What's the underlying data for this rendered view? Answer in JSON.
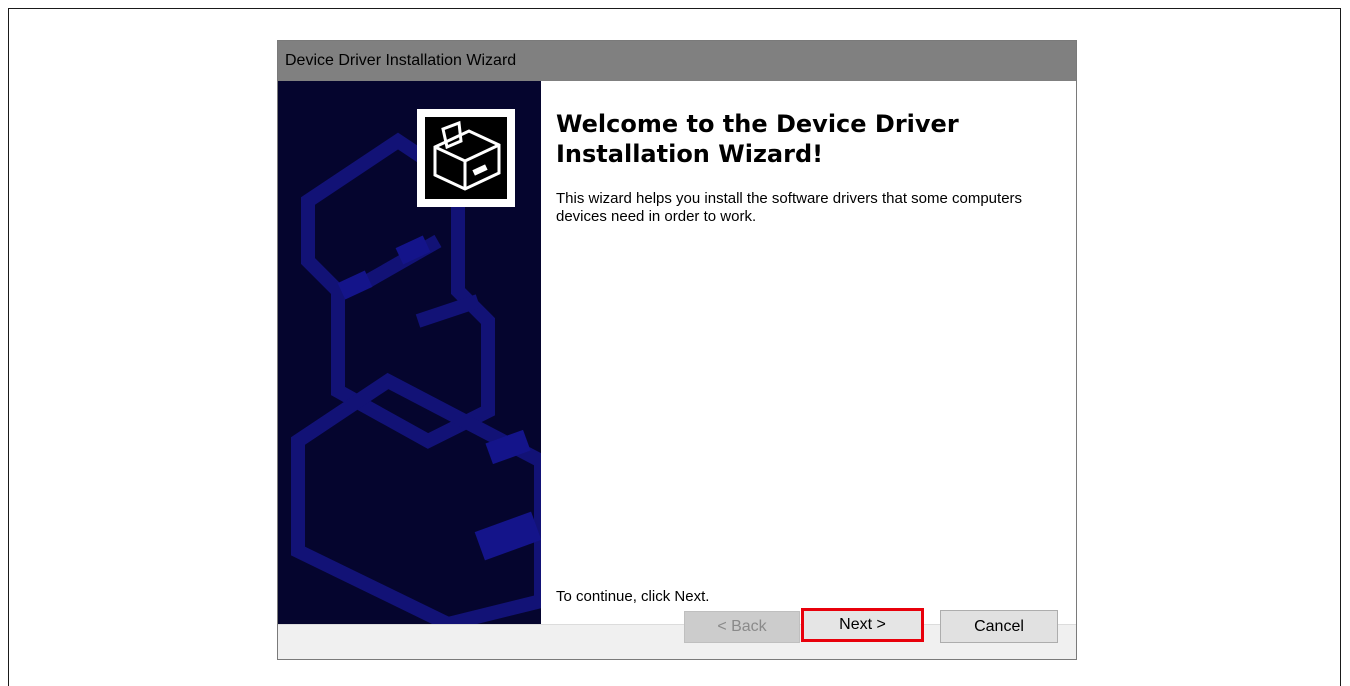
{
  "window": {
    "title": "Device Driver Installation Wizard"
  },
  "banner": {
    "background_color": "#05052e",
    "logo_icon": "driver-box-icon"
  },
  "content": {
    "heading": "Welcome to the Device Driver Installation Wizard!",
    "description": "This wizard helps you install the software drivers that some computers devices need in order to work.",
    "continue_hint": "To continue, click Next."
  },
  "buttons": {
    "back_label": "< Back",
    "next_label": "Next >",
    "cancel_label": "Cancel",
    "back_enabled": false,
    "next_highlight_color": "#e8000b"
  }
}
